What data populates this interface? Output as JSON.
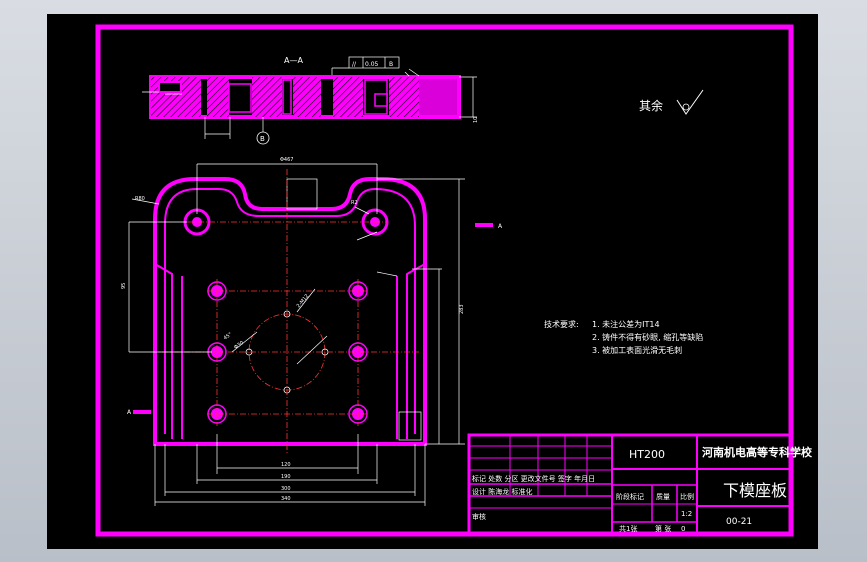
{
  "section_label": "A—A",
  "flatness_frame": [
    "//",
    "0.05",
    "B"
  ],
  "roughness_other": "其余",
  "tech_requirements": {
    "title": "技术要求:",
    "items": [
      "1. 未注公差为IT14",
      "2. 铸件不得有砂眼, 缩孔等缺陷",
      "3. 被加工表面光滑无毛刺"
    ]
  },
  "title_block": {
    "material": "HT200",
    "school": "河南机电高等专科学校",
    "part_name": "下模座板",
    "drawing_no": "00-21",
    "row_revision": "标记 处数  分区  更改文件号 签字 年月日",
    "row_design": "设计   陈海龙    标准化",
    "review": "审核",
    "stage_mark": "阶段标记",
    "weight": "质量",
    "scale_label": "比例",
    "scale_value": "1:2",
    "sheet_total": "共1张",
    "sheet_no": "第 张",
    "sheet_index": "0"
  },
  "view_marks": {
    "a_left": "A",
    "a_right": "A",
    "b_datum": "B"
  },
  "dimensions": {
    "top_width": "Φ467",
    "left_height": "95",
    "right_height": "283",
    "bottom_inner": "120",
    "bottom_mid": "190",
    "bottom_outer": "300",
    "bottom_total": "340",
    "hole_angle": "45°",
    "hole_dia": "Φ30",
    "radius_left": "R80",
    "radius_right": "R2",
    "section_height": "10",
    "bolt_spec": "2-M12"
  },
  "colors": {
    "background": "#000000",
    "outline": "#ff00ff",
    "center_lines": "#ff3333",
    "dimension_lines": "#ffffff"
  }
}
